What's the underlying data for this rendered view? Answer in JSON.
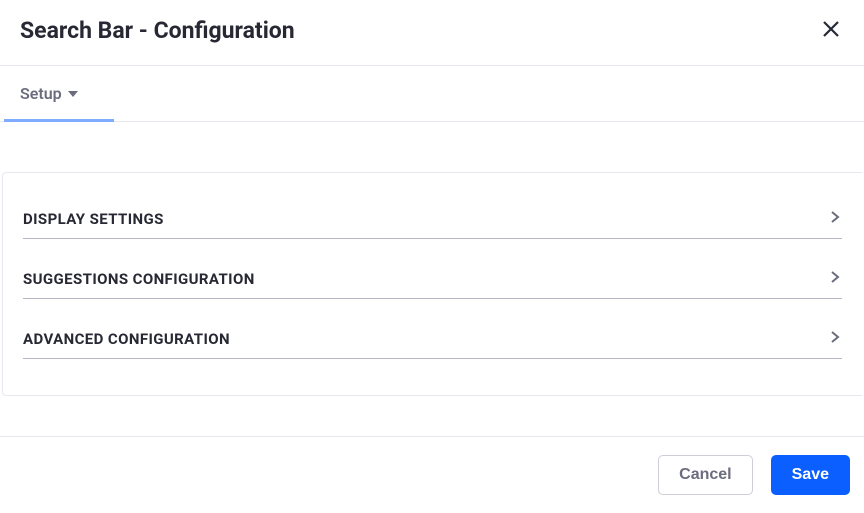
{
  "header": {
    "title": "Search Bar - Configuration"
  },
  "tabs": {
    "active": "Setup"
  },
  "sections": [
    {
      "label": "Display Settings"
    },
    {
      "label": "Suggestions Configuration"
    },
    {
      "label": "Advanced Configuration"
    }
  ],
  "footer": {
    "cancel": "Cancel",
    "save": "Save"
  }
}
